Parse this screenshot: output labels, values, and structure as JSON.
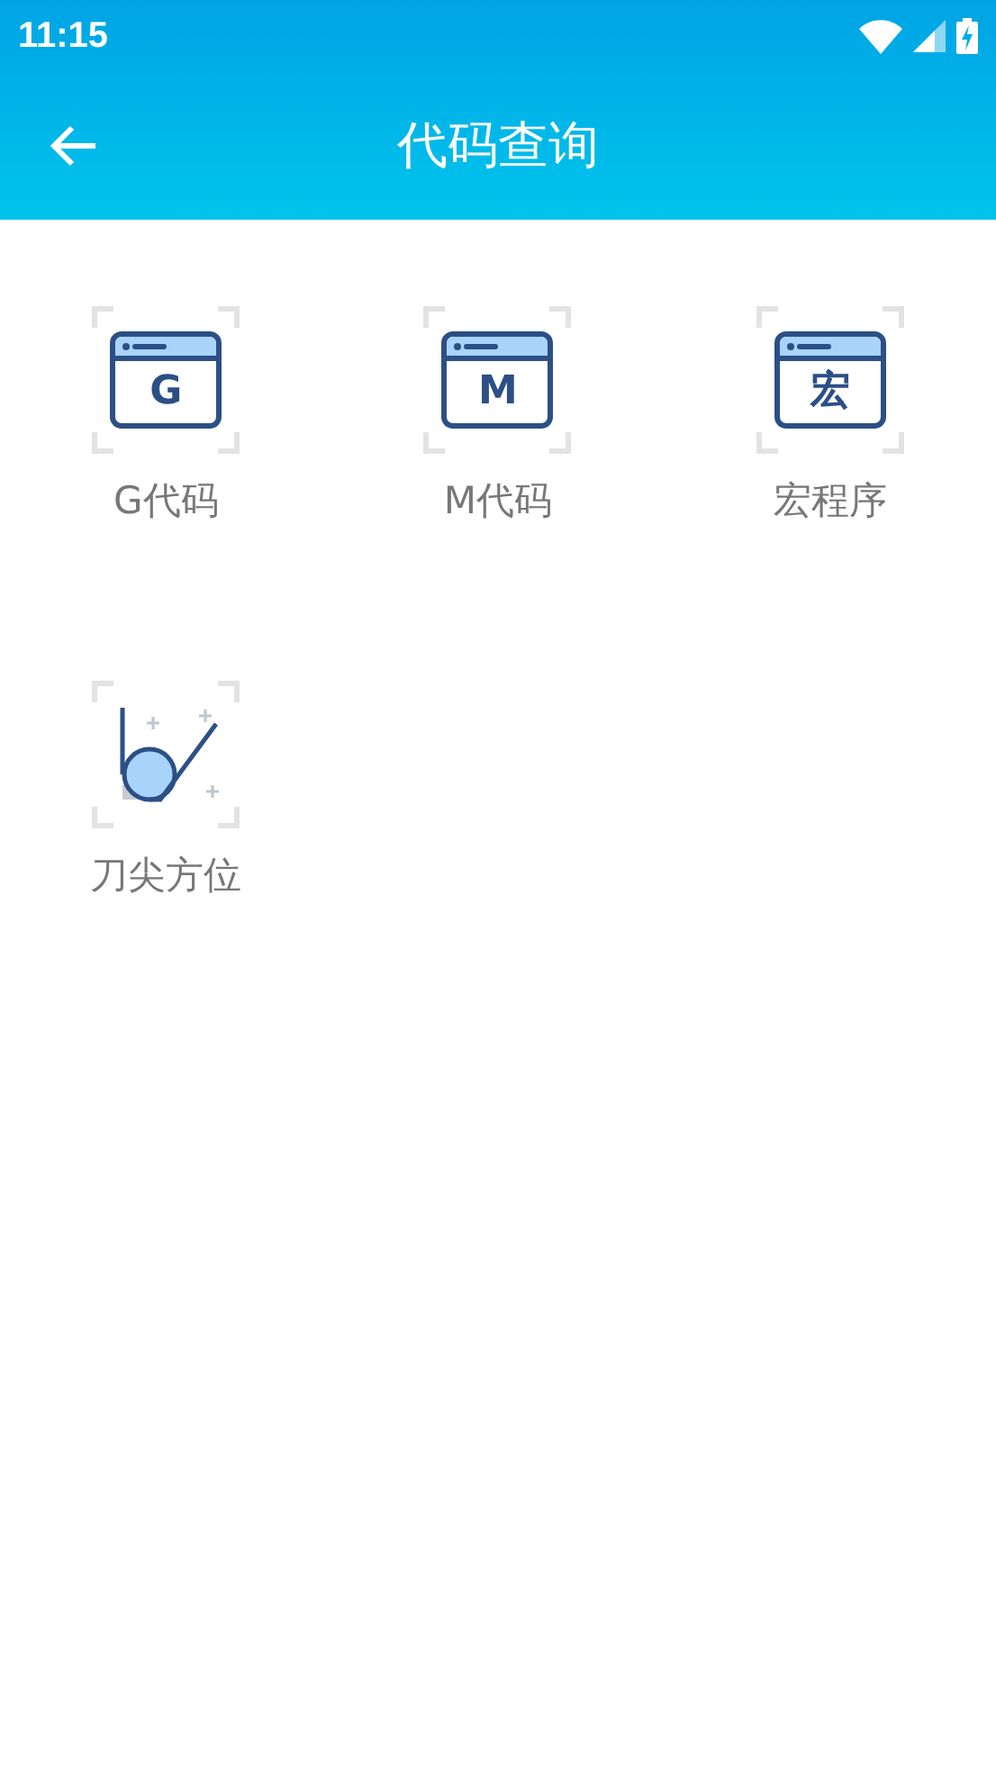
{
  "status_bar": {
    "time": "11:15"
  },
  "toolbar": {
    "title": "代码查询"
  },
  "items": [
    {
      "kind": "window",
      "glyph": "G",
      "label": "G代码"
    },
    {
      "kind": "window",
      "glyph": "M",
      "label": "M代码"
    },
    {
      "kind": "window",
      "glyph": "宏",
      "label": "宏程序"
    },
    {
      "kind": "tool",
      "label": "刀尖方位"
    }
  ]
}
